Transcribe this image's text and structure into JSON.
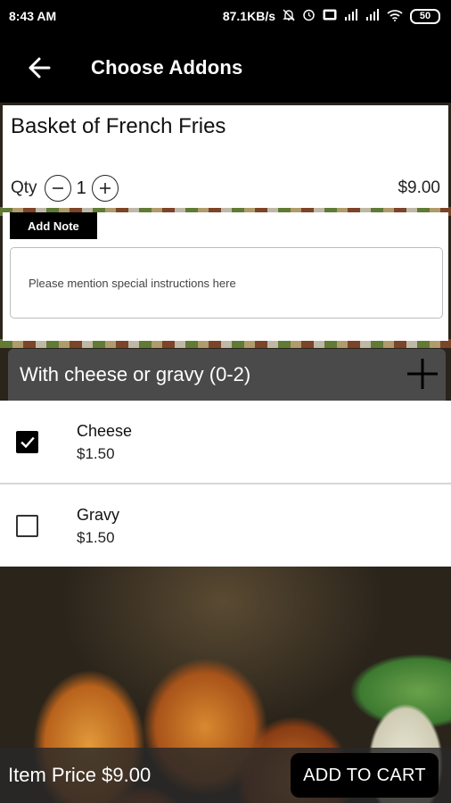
{
  "status_bar": {
    "time": "8:43 AM",
    "network_speed": "87.1KB/s",
    "battery": "50",
    "icons": [
      "mute-icon",
      "alarm-icon",
      "volte-icon",
      "signal-icon",
      "signal-icon",
      "wifi-icon",
      "battery-icon"
    ]
  },
  "app_bar": {
    "title": "Choose Addons",
    "back_icon": "arrow-left-icon"
  },
  "item": {
    "name": "Basket of French Fries",
    "qty_label": "Qty",
    "qty": "1",
    "price": "$9.00"
  },
  "note": {
    "tab_label": "Add Note",
    "placeholder": "Please mention special instructions here"
  },
  "addon_group": {
    "title": "With cheese or gravy (0-2)",
    "options": [
      {
        "name": "Cheese",
        "price": "$1.50",
        "checked": true
      },
      {
        "name": "Gravy",
        "price": "$1.50",
        "checked": false
      }
    ]
  },
  "footer": {
    "item_price_label": "Item Price $9.00",
    "add_to_cart_label": "ADD TO CART"
  },
  "colors": {
    "bar_bg": "#000000",
    "group_header_bg": "#4a4a4a",
    "card_bg": "#ffffff"
  }
}
